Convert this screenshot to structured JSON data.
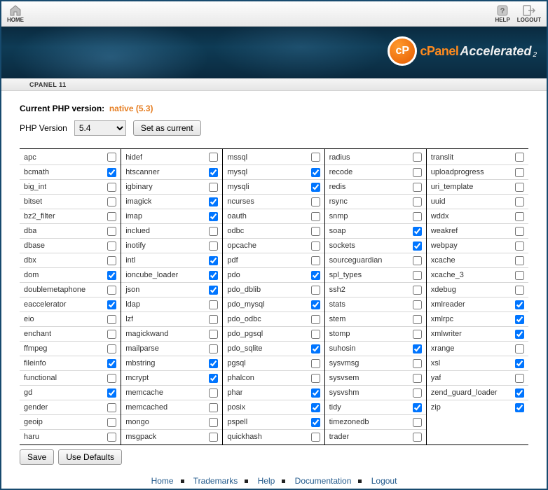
{
  "topbar": {
    "home": "HOME",
    "help": "HELP",
    "logout": "LOGOUT"
  },
  "branding": {
    "product": "cPanel",
    "accel": "Accelerated",
    "sub": "2"
  },
  "breadcrumb": "CPANEL 11",
  "version": {
    "label": "Current PHP version:",
    "current": "native (5.3)",
    "select_label": "PHP Version",
    "options": [
      "5.4"
    ],
    "selected": "5.4",
    "set_btn": "Set as current"
  },
  "buttons": {
    "save": "Save",
    "defaults": "Use Defaults"
  },
  "footer": {
    "home": "Home",
    "trademarks": "Trademarks",
    "help": "Help",
    "documentation": "Documentation",
    "logout": "Logout"
  },
  "extensions": [
    {
      "name": "apc",
      "on": false
    },
    {
      "name": "bcmath",
      "on": true
    },
    {
      "name": "big_int",
      "on": false
    },
    {
      "name": "bitset",
      "on": false
    },
    {
      "name": "bz2_filter",
      "on": false
    },
    {
      "name": "dba",
      "on": false
    },
    {
      "name": "dbase",
      "on": false
    },
    {
      "name": "dbx",
      "on": false
    },
    {
      "name": "dom",
      "on": true
    },
    {
      "name": "doublemetaphone",
      "on": false
    },
    {
      "name": "eaccelerator",
      "on": true
    },
    {
      "name": "eio",
      "on": false
    },
    {
      "name": "enchant",
      "on": false
    },
    {
      "name": "ffmpeg",
      "on": false
    },
    {
      "name": "fileinfo",
      "on": true
    },
    {
      "name": "functional",
      "on": false
    },
    {
      "name": "gd",
      "on": true
    },
    {
      "name": "gender",
      "on": false
    },
    {
      "name": "geoip",
      "on": false
    },
    {
      "name": "haru",
      "on": false
    },
    {
      "name": "hidef",
      "on": false
    },
    {
      "name": "htscanner",
      "on": true
    },
    {
      "name": "igbinary",
      "on": false
    },
    {
      "name": "imagick",
      "on": true
    },
    {
      "name": "imap",
      "on": true
    },
    {
      "name": "inclued",
      "on": false
    },
    {
      "name": "inotify",
      "on": false
    },
    {
      "name": "intl",
      "on": true
    },
    {
      "name": "ioncube_loader",
      "on": true
    },
    {
      "name": "json",
      "on": true
    },
    {
      "name": "ldap",
      "on": false
    },
    {
      "name": "lzf",
      "on": false
    },
    {
      "name": "magickwand",
      "on": false
    },
    {
      "name": "mailparse",
      "on": false
    },
    {
      "name": "mbstring",
      "on": true
    },
    {
      "name": "mcrypt",
      "on": true
    },
    {
      "name": "memcache",
      "on": false
    },
    {
      "name": "memcached",
      "on": false
    },
    {
      "name": "mongo",
      "on": false
    },
    {
      "name": "msgpack",
      "on": false
    },
    {
      "name": "mssql",
      "on": false
    },
    {
      "name": "mysql",
      "on": true
    },
    {
      "name": "mysqli",
      "on": true
    },
    {
      "name": "ncurses",
      "on": false
    },
    {
      "name": "oauth",
      "on": false
    },
    {
      "name": "odbc",
      "on": false
    },
    {
      "name": "opcache",
      "on": false
    },
    {
      "name": "pdf",
      "on": false
    },
    {
      "name": "pdo",
      "on": true
    },
    {
      "name": "pdo_dblib",
      "on": false
    },
    {
      "name": "pdo_mysql",
      "on": true
    },
    {
      "name": "pdo_odbc",
      "on": false
    },
    {
      "name": "pdo_pgsql",
      "on": false
    },
    {
      "name": "pdo_sqlite",
      "on": true
    },
    {
      "name": "pgsql",
      "on": false
    },
    {
      "name": "phalcon",
      "on": false
    },
    {
      "name": "phar",
      "on": true
    },
    {
      "name": "posix",
      "on": true
    },
    {
      "name": "pspell",
      "on": true
    },
    {
      "name": "quickhash",
      "on": false
    },
    {
      "name": "radius",
      "on": false
    },
    {
      "name": "recode",
      "on": false
    },
    {
      "name": "redis",
      "on": false
    },
    {
      "name": "rsync",
      "on": false
    },
    {
      "name": "snmp",
      "on": false
    },
    {
      "name": "soap",
      "on": true
    },
    {
      "name": "sockets",
      "on": true
    },
    {
      "name": "sourceguardian",
      "on": false
    },
    {
      "name": "spl_types",
      "on": false
    },
    {
      "name": "ssh2",
      "on": false
    },
    {
      "name": "stats",
      "on": false
    },
    {
      "name": "stem",
      "on": false
    },
    {
      "name": "stomp",
      "on": false
    },
    {
      "name": "suhosin",
      "on": true
    },
    {
      "name": "sysvmsg",
      "on": false
    },
    {
      "name": "sysvsem",
      "on": false
    },
    {
      "name": "sysvshm",
      "on": false
    },
    {
      "name": "tidy",
      "on": true
    },
    {
      "name": "timezonedb",
      "on": false
    },
    {
      "name": "trader",
      "on": false
    },
    {
      "name": "translit",
      "on": false
    },
    {
      "name": "uploadprogress",
      "on": false
    },
    {
      "name": "uri_template",
      "on": false
    },
    {
      "name": "uuid",
      "on": false
    },
    {
      "name": "wddx",
      "on": false
    },
    {
      "name": "weakref",
      "on": false
    },
    {
      "name": "webpay",
      "on": false
    },
    {
      "name": "xcache",
      "on": false
    },
    {
      "name": "xcache_3",
      "on": false
    },
    {
      "name": "xdebug",
      "on": false
    },
    {
      "name": "xmlreader",
      "on": true
    },
    {
      "name": "xmlrpc",
      "on": true
    },
    {
      "name": "xmlwriter",
      "on": true
    },
    {
      "name": "xrange",
      "on": false
    },
    {
      "name": "xsl",
      "on": true
    },
    {
      "name": "yaf",
      "on": false
    },
    {
      "name": "zend_guard_loader",
      "on": true
    },
    {
      "name": "zip",
      "on": true
    }
  ]
}
